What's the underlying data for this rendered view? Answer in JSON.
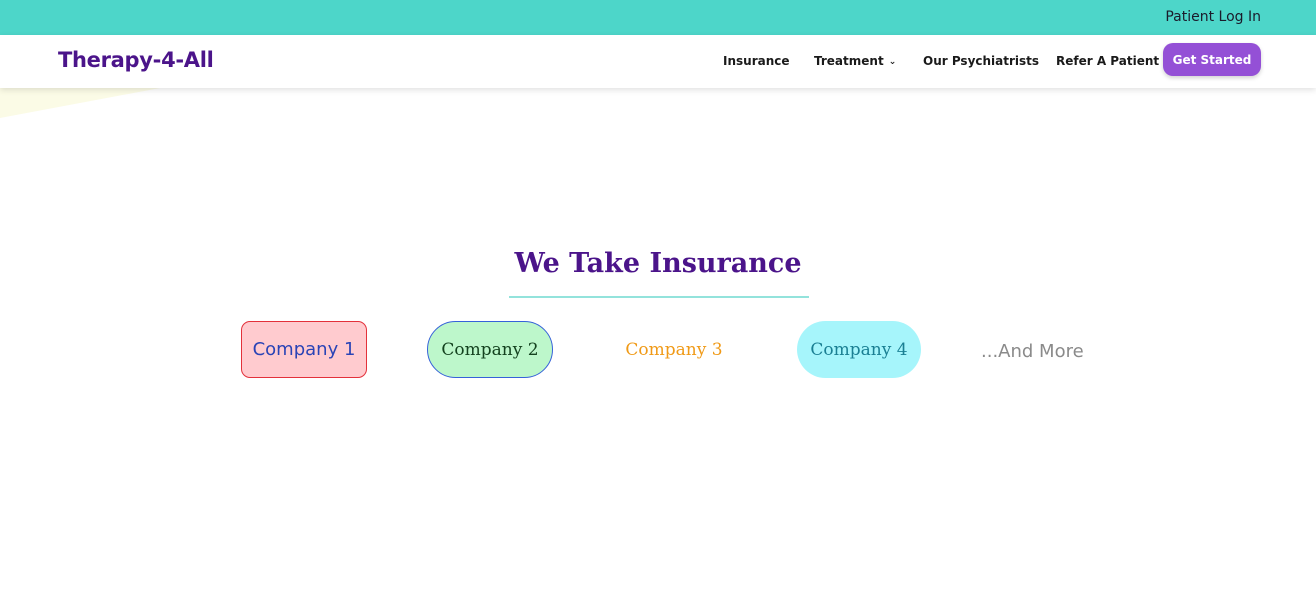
{
  "topbar": {
    "patient_login_label": "Patient Log In",
    "background_color": "#4dd6c9"
  },
  "navbar": {
    "logo": "Therapy-4-All",
    "items": [
      {
        "label": "Insurance"
      },
      {
        "label": "Treatment",
        "has_dropdown": true,
        "icon": "chevron-down-icon"
      },
      {
        "label": "Our Psychiatrists"
      },
      {
        "label": "Refer A Patient"
      }
    ],
    "cta_label": "Get Started",
    "cta_color": "#9450d6",
    "brand_color": "#4b148a"
  },
  "insurance": {
    "title": "We Take Insurance",
    "companies": [
      {
        "label": "Company 1"
      },
      {
        "label": "Company 2"
      },
      {
        "label": "Company 3"
      },
      {
        "label": "Company 4"
      }
    ],
    "more_label": "...And More"
  }
}
